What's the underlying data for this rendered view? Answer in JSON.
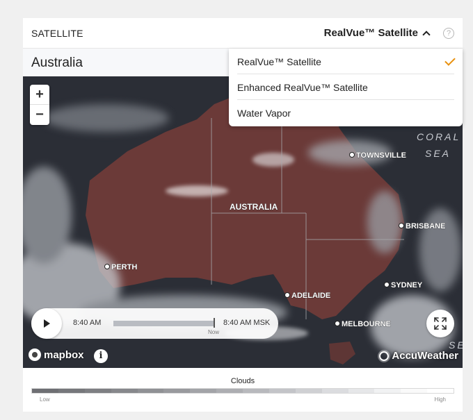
{
  "header": {
    "title": "SATELLITE",
    "selected_layer": "RealVue™ Satellite",
    "help": "?"
  },
  "region": {
    "name": "Australia"
  },
  "dropdown": {
    "items": [
      {
        "label": "RealVue™ Satellite",
        "selected": true
      },
      {
        "label": "Enhanced RealVue™ Satellite",
        "selected": false
      },
      {
        "label": "Water Vapor",
        "selected": false
      }
    ]
  },
  "zoom": {
    "in": "+",
    "out": "−"
  },
  "map_labels": {
    "country": "AUSTRALIA",
    "sea_line1": "CORAL",
    "sea_line2": "SEA",
    "sea_partial": "SE",
    "cities": {
      "townsville": "TOWNSVILLE",
      "brisbane": "BRISBANE",
      "perth": "PERTH",
      "sydney": "SYDNEY",
      "adelaide": "ADELAIDE",
      "melbourne": "MELBOURNE"
    }
  },
  "player": {
    "start_time": "8:40 AM",
    "end_time": "8:40 AM MSK",
    "now_label": "Now"
  },
  "attribution": {
    "mapbox": "mapbox",
    "info": "i",
    "accuweather": "AccuWeather"
  },
  "legend": {
    "title": "Clouds",
    "low": "Low",
    "high": "High",
    "colors": [
      "#6e6f73",
      "#76777b",
      "#7e7f83",
      "#87888c",
      "#909195",
      "#999a9e",
      "#a3a4a8",
      "#adaeb2",
      "#b8b9bd",
      "#c3c4c8",
      "#cfd0d3",
      "#dbdcdf",
      "#e6e7e9",
      "#f1f2f3",
      "#fafafa",
      "#ffffff"
    ]
  },
  "colors": {
    "accent_check": "#e8900c",
    "land": "#6b3a38",
    "ocean": "#2b2e36"
  }
}
